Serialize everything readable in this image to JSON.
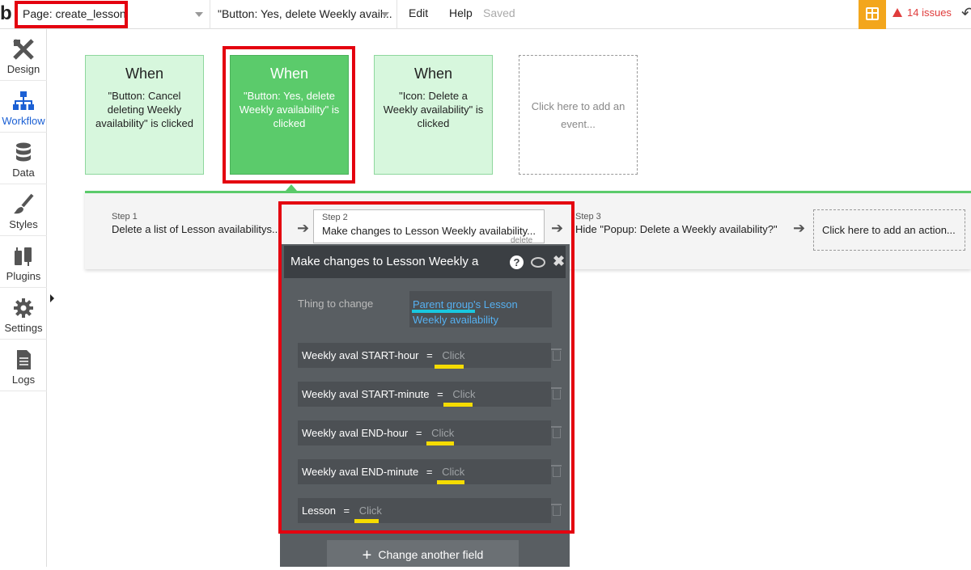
{
  "topbar": {
    "logo": "b",
    "page_select": "Page: create_lesson",
    "workflow_select": "\"Button: Yes, delete Weekly avail...",
    "edit": "Edit",
    "help": "Help",
    "saved": "Saved",
    "issues": "14 issues",
    "issues_color": "#e03c3c",
    "gift_color": "#f3a61c"
  },
  "sidebar": {
    "items": [
      {
        "label": "Design",
        "icon": "design-icon"
      },
      {
        "label": "Workflow",
        "icon": "workflow-icon",
        "active": true
      },
      {
        "label": "Data",
        "icon": "database-icon"
      },
      {
        "label": "Styles",
        "icon": "brush-icon"
      },
      {
        "label": "Plugins",
        "icon": "plugin-icon"
      },
      {
        "label": "Settings",
        "icon": "gear-icon"
      },
      {
        "label": "Logs",
        "icon": "document-icon"
      }
    ],
    "active_color": "#1b60d4"
  },
  "events": [
    {
      "when": "When",
      "desc": "\"Button: Cancel deleting Weekly availability\" is clicked"
    },
    {
      "when": "When",
      "desc": "\"Button: Yes, delete Weekly availability\" is clicked"
    },
    {
      "when": "When",
      "desc": "\"Icon: Delete a Weekly availability\" is clicked"
    }
  ],
  "add_event": "Click here to add an event...",
  "steps": [
    {
      "num": "Step 1",
      "label": "Delete a list of Lesson availabilitys..."
    },
    {
      "num": "Step 2",
      "label": "Make changes to Lesson Weekly availability..."
    },
    {
      "num": "Step 3",
      "label": "Hide \"Popup: Delete a Weekly availability?\""
    }
  ],
  "step_delete": "delete",
  "add_action": "Click here to add an action...",
  "panel": {
    "title": "Make changes to Lesson Weekly a",
    "help": "?",
    "close": "✖",
    "thing_label": "Thing to change",
    "thing_value": "Parent group's Lesson Weekly availability",
    "fields": [
      {
        "name": "Weekly aval START-hour",
        "eq": "=",
        "value": "Click"
      },
      {
        "name": "Weekly aval START-minute",
        "eq": "=",
        "value": "Click"
      },
      {
        "name": "Weekly aval END-hour",
        "eq": "=",
        "value": "Click"
      },
      {
        "name": "Weekly aval END-minute",
        "eq": "=",
        "value": "Click"
      },
      {
        "name": "Lesson",
        "eq": "=",
        "value": "Click"
      }
    ],
    "change_btn": "Change another field",
    "plus": "+"
  },
  "colors": {
    "event_bg": "#d7f7dd",
    "event_selected": "#5bcb6b",
    "annotation_red": "#e4000f",
    "annotation_yellow": "#f5dc00",
    "annotation_cyan": "#19c7df"
  }
}
